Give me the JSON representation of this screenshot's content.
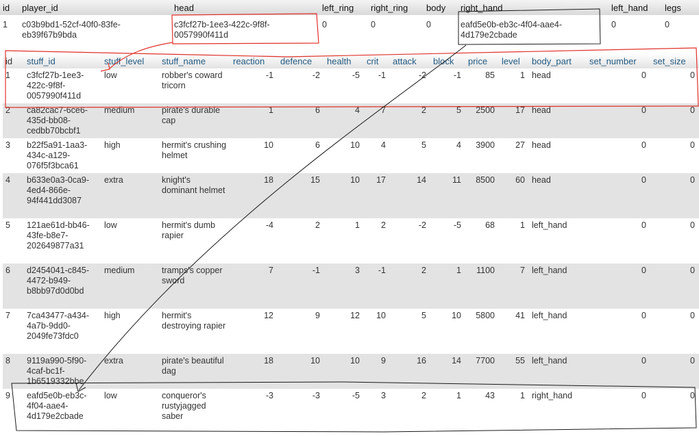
{
  "player_table": {
    "columns": [
      "id",
      "player_id",
      "head",
      "left_ring",
      "right_ring",
      "body",
      "right_hand",
      "left_hand",
      "legs"
    ],
    "row": [
      "1",
      "c03b9bd1-52cf-40f0-83fe-eb39f67b9bda",
      "c3fcf27b-1ee3-422c-9f8f-0057990f411d",
      "0",
      "0",
      "0",
      "eafd5e0b-eb3c-4f04-aae4-4d179e2cbade",
      "0",
      "0"
    ]
  },
  "stuff_table": {
    "columns": [
      "id",
      "stuff_id",
      "stuff_level",
      "stuff_name",
      "reaction",
      "defence",
      "health",
      "crit",
      "attack",
      "block",
      "price",
      "level",
      "body_part",
      "set_number",
      "set_size"
    ],
    "rows": [
      [
        "1",
        "c3fcf27b-1ee3-422c-9f8f-0057990f411d",
        "low",
        "robber's coward tricorn",
        "-1",
        "-2",
        "-5",
        "-1",
        "-2",
        "-1",
        "85",
        "1",
        "head",
        "0",
        "0"
      ],
      [
        "2",
        "ca82cac7-6ce6-435d-bb08-cedbb70bcbf1",
        "medium",
        "pirate's durable cap",
        "1",
        "6",
        "4",
        "7",
        "2",
        "5",
        "2500",
        "17",
        "head",
        "0",
        "0"
      ],
      [
        "3",
        "b22f5a91-1aa3-434c-a129-076f5f3bca61",
        "high",
        "hermit's crushing helmet",
        "10",
        "6",
        "10",
        "4",
        "5",
        "4",
        "3900",
        "27",
        "head",
        "0",
        "0"
      ],
      [
        "4",
        "b633e0a3-0ca9-4ed4-866e-94f441dd3087",
        "extra",
        "knight's dominant helmet",
        "18",
        "15",
        "10",
        "17",
        "14",
        "11",
        "8500",
        "60",
        "head",
        "0",
        "0"
      ],
      [
        "5",
        "121ae61d-bb46-43fe-b8e7-202649877a31",
        "low",
        "hermit's dumb rapier",
        "-4",
        "2",
        "1",
        "2",
        "-2",
        "-5",
        "68",
        "1",
        "left_hand",
        "0",
        "0"
      ],
      [
        "6",
        "d2454041-c845-4472-b949-b8bb97d0d0bd",
        "medium",
        "tramps's copper sword",
        "7",
        "-1",
        "3",
        "-1",
        "2",
        "1",
        "1100",
        "7",
        "left_hand",
        "0",
        "0"
      ],
      [
        "7",
        "7ca43477-a434-4a7b-9dd0-2049fe73fdc0",
        "high",
        "hermit's destroying rapier",
        "12",
        "9",
        "12",
        "10",
        "5",
        "10",
        "5800",
        "41",
        "left_hand",
        "0",
        "0"
      ],
      [
        "8",
        "9119a990-5f90-4caf-bc1f-1b6519332bbe",
        "extra",
        "pirate's beautiful dag",
        "18",
        "10",
        "10",
        "9",
        "16",
        "14",
        "7700",
        "55",
        "left_hand",
        "0",
        "0"
      ],
      [
        "9",
        "eafd5e0b-eb3c-4f04-aae4-4d179e2cbade",
        "low",
        "conqueror's rustyjagged saber",
        "-3",
        "-3",
        "-5",
        "3",
        "2",
        "1",
        "43",
        "1",
        "right_hand",
        "0",
        "0"
      ]
    ],
    "row_heights": [
      51,
      51,
      51,
      66,
      66,
      66,
      66,
      51,
      56
    ]
  },
  "annotation_colors": {
    "red": "#e0312a",
    "black": "#1a1a1a"
  }
}
